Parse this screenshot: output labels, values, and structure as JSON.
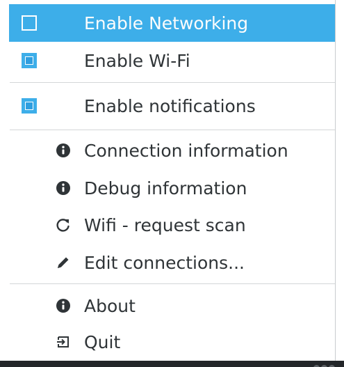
{
  "menu": {
    "items": [
      {
        "label": "Enable Networking",
        "type": "checkbox",
        "checked": false,
        "highlighted": true
      },
      {
        "label": "Enable Wi-Fi",
        "type": "checkbox",
        "checked": true
      },
      {
        "label": "Enable notifications",
        "type": "checkbox",
        "checked": true
      },
      {
        "label": "Connection information",
        "icon": "info-icon"
      },
      {
        "label": "Debug information",
        "icon": "info-icon"
      },
      {
        "label": "Wifi - request scan",
        "icon": "refresh-icon"
      },
      {
        "label": "Edit connections...",
        "icon": "pencil-icon"
      },
      {
        "label": "About",
        "icon": "info-icon"
      },
      {
        "label": "Quit",
        "icon": "exit-icon"
      }
    ]
  },
  "colors": {
    "highlight": "#3daee9",
    "text": "#2f3437",
    "highlight_text": "#fcfcfc",
    "separator": "#d3d6d8",
    "panel": "#232629"
  }
}
